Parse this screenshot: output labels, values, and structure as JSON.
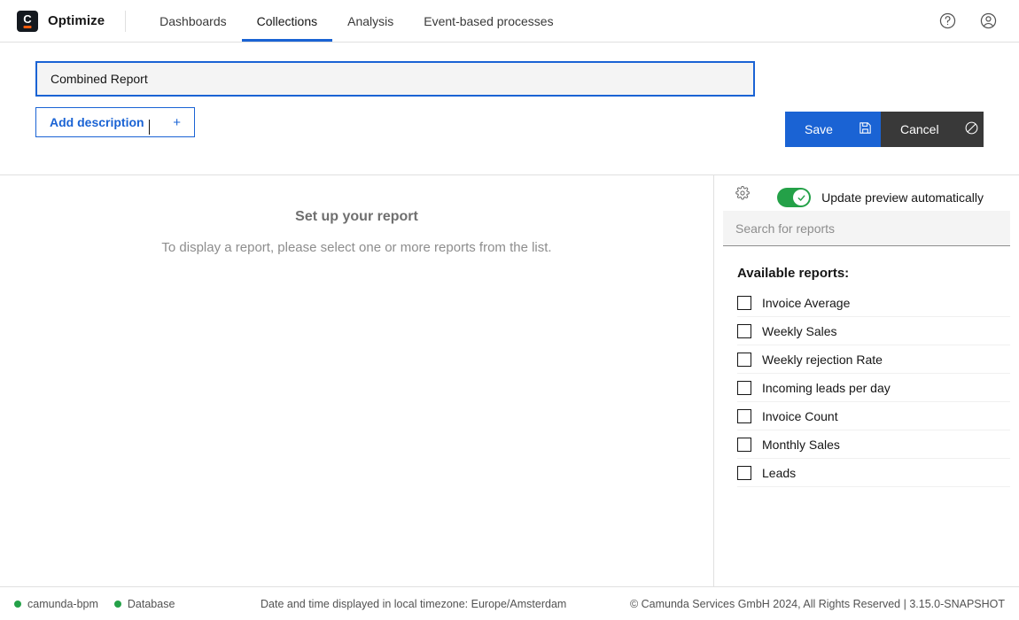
{
  "header": {
    "brand": "Optimize",
    "logo_icon": "camunda-logo-icon",
    "nav": [
      {
        "label": "Dashboards",
        "active": false
      },
      {
        "label": "Collections",
        "active": true
      },
      {
        "label": "Analysis",
        "active": false
      },
      {
        "label": "Event-based processes",
        "active": false
      }
    ],
    "help_icon": "help-circle-icon",
    "user_icon": "user-avatar-icon"
  },
  "titlebar": {
    "report_name": "Combined Report",
    "report_name_placeholder": "Report name",
    "add_description_label": "Add description",
    "add_description_icon": "plus-icon",
    "save_label": "Save",
    "save_icon": "floppy-disk-icon",
    "cancel_label": "Cancel",
    "cancel_icon": "no-entry-icon",
    "preview_toggle_label": "Update preview automatically",
    "preview_toggle_on": true
  },
  "main": {
    "empty_title": "Set up your report",
    "empty_subtitle": "To display a report, please select one or more reports from the list."
  },
  "side": {
    "gear_icon": "gear-icon",
    "search_placeholder": "Search for reports",
    "search_value": "",
    "available_title": "Available reports:",
    "reports": [
      {
        "label": "Invoice Average",
        "checked": false
      },
      {
        "label": "Weekly Sales",
        "checked": false
      },
      {
        "label": "Weekly rejection Rate",
        "checked": false
      },
      {
        "label": "Incoming leads per day",
        "checked": false
      },
      {
        "label": "Invoice Count",
        "checked": false
      },
      {
        "label": "Monthly Sales",
        "checked": false
      },
      {
        "label": "Leads",
        "checked": false
      }
    ]
  },
  "footer": {
    "connections": [
      {
        "label": "camunda-bpm",
        "status_color": "#24a148"
      },
      {
        "label": "Database",
        "status_color": "#24a148"
      }
    ],
    "timezone_note": "Date and time displayed in local timezone: Europe/Amsterdam",
    "copyright": "© Camunda Services GmbH 2024, All Rights Reserved | 3.15.0-SNAPSHOT"
  },
  "colors": {
    "accent_blue": "#1a63d4",
    "dark_button": "#393939",
    "toggle_green": "#24a148",
    "logo_orange": "#fc5d0d"
  }
}
